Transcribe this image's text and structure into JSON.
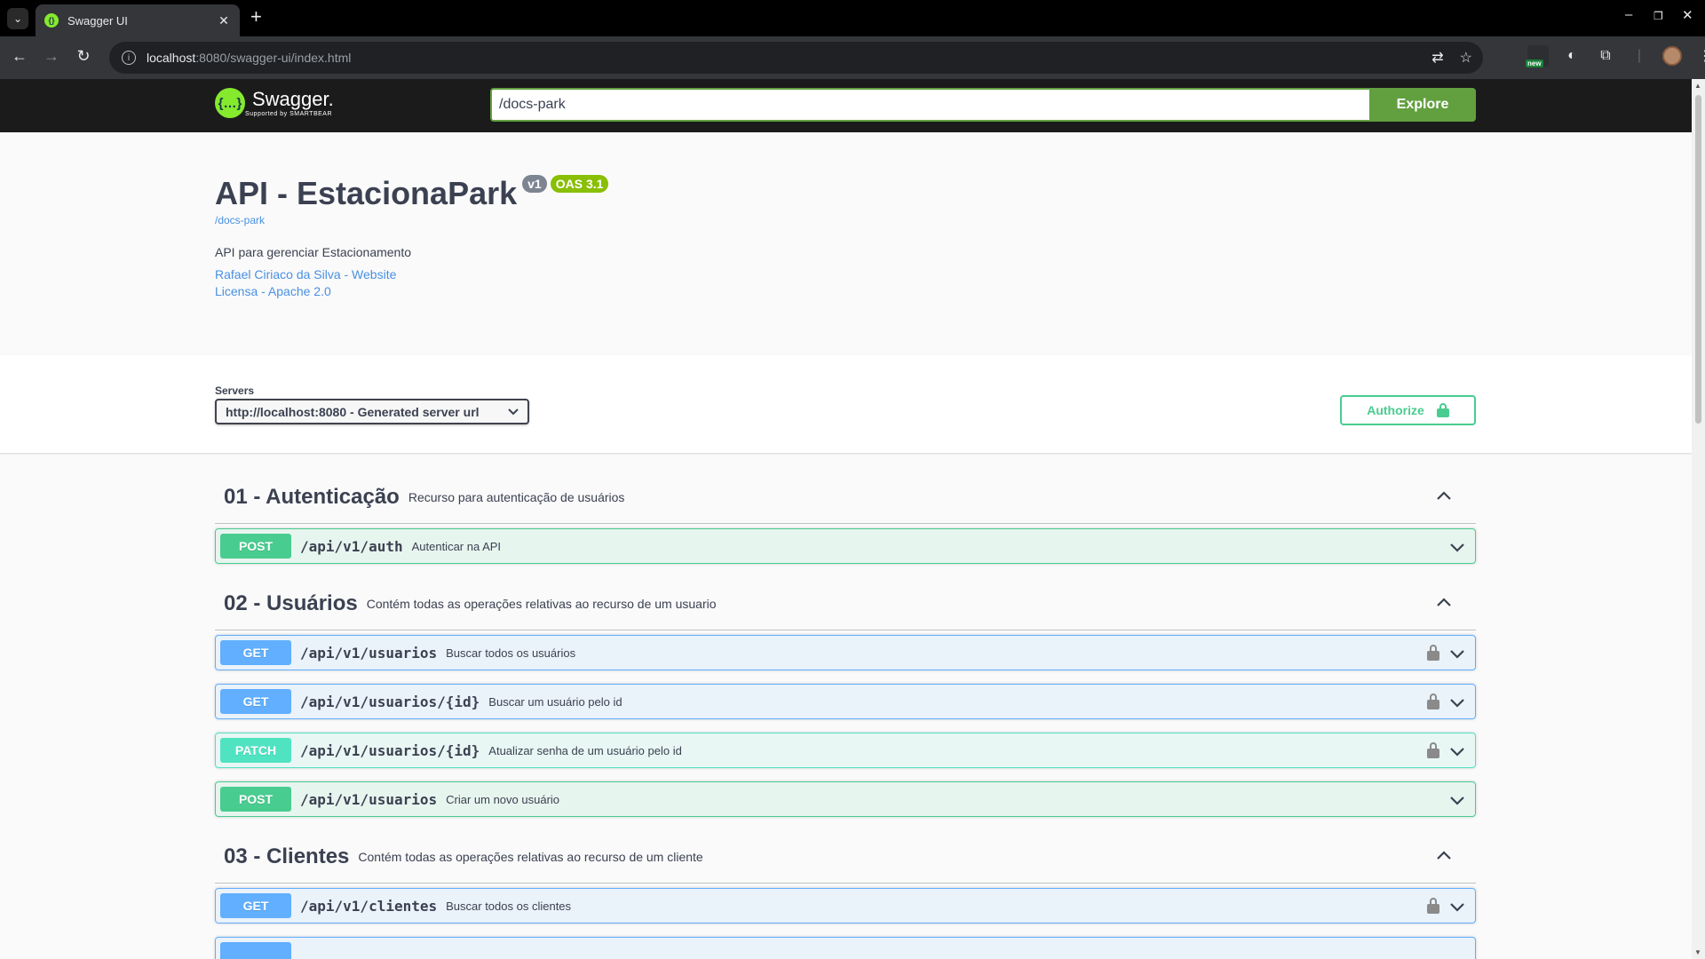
{
  "browser": {
    "tab_title": "Swagger UI",
    "url_host": "localhost",
    "url_rest": ":8080/swagger-ui/index.html",
    "new_badge": "new"
  },
  "topbar": {
    "logo_text": "Swagger.",
    "logo_subtext": "Supported by SMARTBEAR",
    "search_value": "/docs-park",
    "explore_label": "Explore"
  },
  "info": {
    "title": "API - EstacionaPark",
    "version_badge": "v1",
    "oas_badge": "OAS 3.1",
    "base_url": "/docs-park",
    "description": "API para gerenciar Estacionamento",
    "contact_link": "Rafael Ciriaco da Silva - Website",
    "license_link": "Licensa - Apache 2.0"
  },
  "servers": {
    "label": "Servers",
    "selected": "http://localhost:8080 - Generated server url",
    "authorize_label": "Authorize"
  },
  "tags": [
    {
      "name": "01 - Autenticação",
      "description": "Recurso para autenticação de usuários",
      "operations": [
        {
          "method": "POST",
          "path": "/api/v1/auth",
          "summary": "Autenticar na API",
          "locked": false
        }
      ]
    },
    {
      "name": "02 - Usuários",
      "description": "Contém todas as operações relativas ao recurso de um usuario",
      "operations": [
        {
          "method": "GET",
          "path": "/api/v1/usuarios",
          "summary": "Buscar todos os usuários",
          "locked": true
        },
        {
          "method": "GET",
          "path": "/api/v1/usuarios/{id}",
          "summary": "Buscar um usuário pelo id",
          "locked": true
        },
        {
          "method": "PATCH",
          "path": "/api/v1/usuarios/{id}",
          "summary": "Atualizar senha de um usuário pelo id",
          "locked": true
        },
        {
          "method": "POST",
          "path": "/api/v1/usuarios",
          "summary": "Criar um novo usuário",
          "locked": false
        }
      ]
    },
    {
      "name": "03 - Clientes",
      "description": "Contém todas as operações relativas ao recurso de um cliente",
      "operations": [
        {
          "method": "GET",
          "path": "/api/v1/clientes",
          "summary": "Buscar todos os clientes",
          "locked": true
        }
      ]
    }
  ],
  "colors": {
    "post": "#49cc90",
    "get": "#61affe",
    "patch": "#50e3c2",
    "explore": "#62a03f",
    "topbar": "#1b1b1b"
  }
}
